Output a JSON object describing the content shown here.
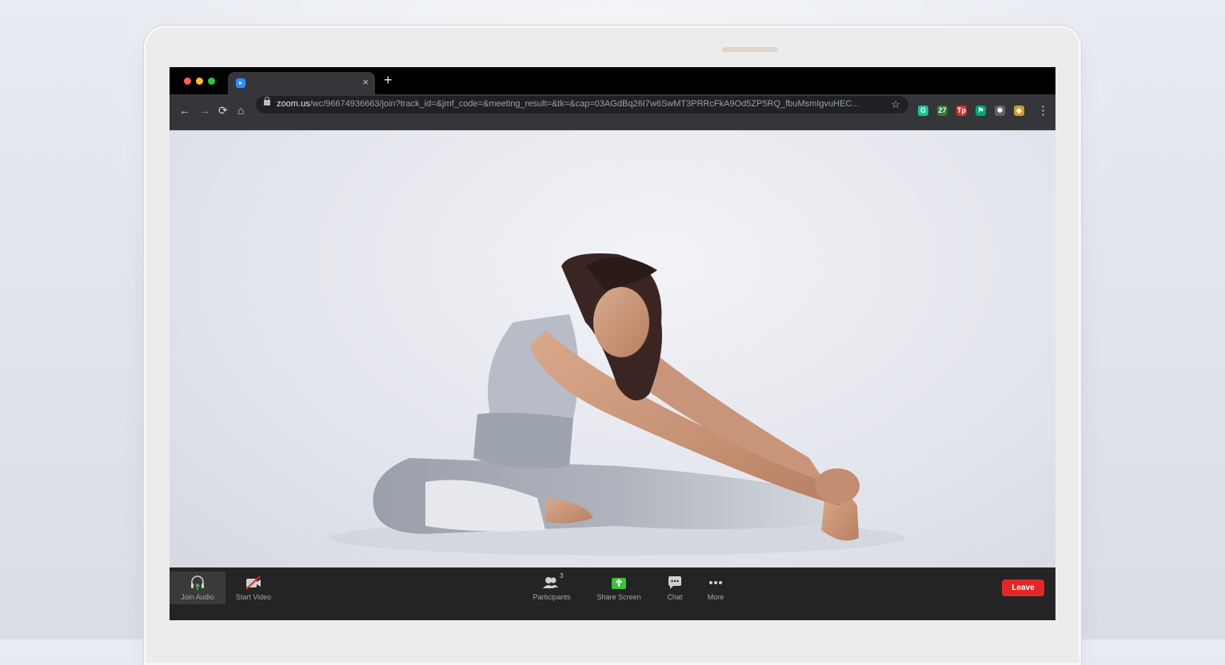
{
  "browser": {
    "tab_close": "×",
    "new_tab": "+",
    "nav": {
      "back": "←",
      "forward": "→",
      "reload": "⟳",
      "home": "⌂"
    },
    "url_host": "zoom.us",
    "url_path": "/wc/96674936663/join?track_id=&jmf_code=&meeting_result=&tk=&cap=03AGdBq26I7w6SwMT3PRRcFkA9Od5ZP5RQ_fbuMsmIgvuHEC...",
    "bookmark_star": "☆",
    "menu": "⋮",
    "extensions": [
      {
        "name": "grammarly-icon",
        "text": "G",
        "color": "#15c39a"
      },
      {
        "name": "extension-27-icon",
        "text": "27",
        "color": "#2e7d32"
      },
      {
        "name": "tp-icon",
        "text": "Tp",
        "color": "#d32f2f"
      },
      {
        "name": "flag-extension-icon",
        "text": "⚑",
        "color": "#00a86b"
      },
      {
        "name": "puzzle-icon",
        "text": "✱",
        "color": "#5f6368"
      },
      {
        "name": "fox-extension-icon",
        "text": "◆",
        "color": "#d39b2a"
      }
    ]
  },
  "zoom": {
    "join_audio": "Join Audio",
    "start_video": "Start Video",
    "participants": "Participants",
    "participant_count": "3",
    "share_screen": "Share Screen",
    "chat": "Chat",
    "more": "More",
    "leave": "Leave",
    "share_color": "#3fbf3f",
    "leave_color": "#e02828"
  }
}
